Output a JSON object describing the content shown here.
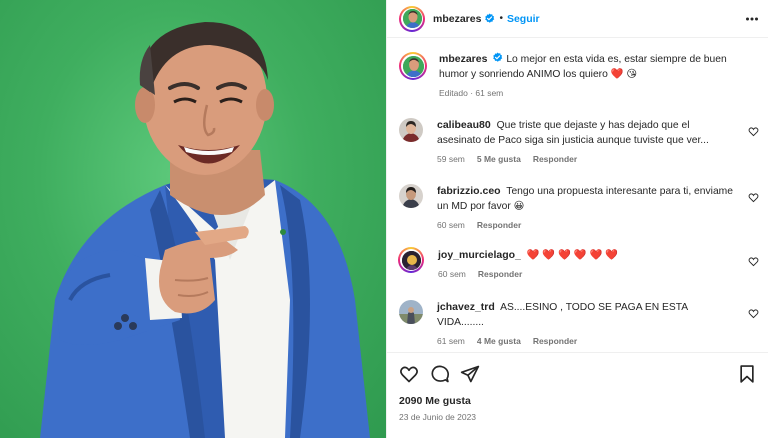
{
  "post": {
    "username": "mbezares",
    "follow_label": "Seguir",
    "separator": "•",
    "caption": "Lo mejor en esta vida es, estar siempre de buen humor y sonriendo ANIMO los quiero ❤️ 😘",
    "caption_meta": "Editado · 61 sem",
    "likes": "2090 Me gusta",
    "date": "23 de Junio de 2023"
  },
  "comments": [
    {
      "username": "calibeau80",
      "text": "Que triste que dejaste y has dejado que el asesinato de Paco siga sin justicia aunque tuviste que ver...",
      "time": "59 sem",
      "likes": "5 Me gusta",
      "reply": "Responder"
    },
    {
      "username": "fabrizzio.ceo",
      "text": "Tengo una propuesta interesante para ti, enviame un MD por favor 😀",
      "time": "60 sem",
      "likes": "",
      "reply": "Responder"
    },
    {
      "username": "joy_murcielago_",
      "text": "❤️ ❤️ ❤️ ❤️ ❤️ ❤️",
      "time": "60 sem",
      "likes": "",
      "reply": "Responder"
    },
    {
      "username": "jchavez_trd",
      "text": "AS....ESINO , TODO SE PAGA EN ESTA VIDA........",
      "time": "61 sem",
      "likes": "4 Me gusta",
      "reply": "Responder"
    }
  ],
  "icons": {
    "more": "more-options-icon",
    "verified": "verified-badge-icon",
    "like": "heart-icon",
    "comment": "comment-icon",
    "share": "share-icon",
    "save": "bookmark-icon"
  },
  "colors": {
    "follow": "#0095f6",
    "verified": "#0095f6",
    "photo_background": "#3fae5f",
    "heart": "#ed4956"
  }
}
